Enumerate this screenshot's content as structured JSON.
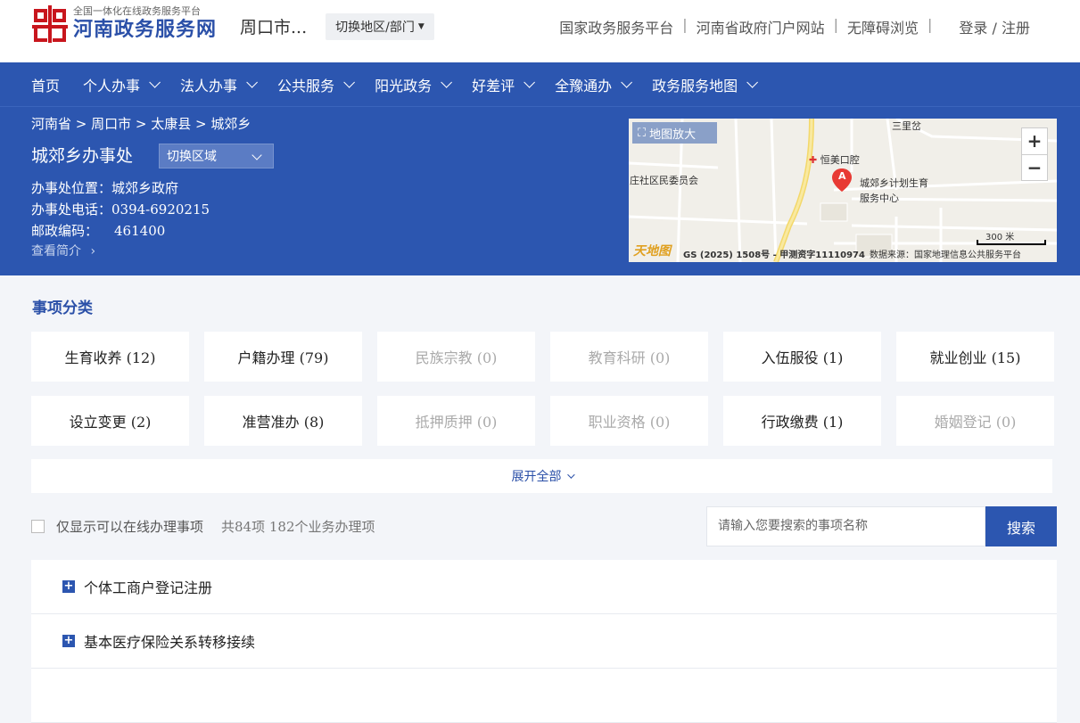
{
  "header": {
    "tagline": "全国一体化在线政务服务平台",
    "site_name": "河南政务服务网",
    "city": "周口市...",
    "switch_label": "切换地区/部门",
    "links": [
      "国家政务服务平台",
      "河南省政府门户网站",
      "无障碍浏览"
    ],
    "login": "登录 / 注册"
  },
  "nav": {
    "items": [
      {
        "label": "首页",
        "dropdown": false
      },
      {
        "label": "个人办事",
        "dropdown": true
      },
      {
        "label": "法人办事",
        "dropdown": true
      },
      {
        "label": "公共服务",
        "dropdown": true
      },
      {
        "label": "阳光政务",
        "dropdown": true
      },
      {
        "label": "好差评",
        "dropdown": true
      },
      {
        "label": "全豫通办",
        "dropdown": true
      },
      {
        "label": "政务服务地图",
        "dropdown": true
      }
    ]
  },
  "banner": {
    "breadcrumb": "河南省 > 周口市 > 太康县 > 城郊乡",
    "office_name": "城郊乡办事处",
    "area_select": "切换区域",
    "location": "办事处位置：城郊乡政府",
    "phone": "办事处电话：0394-6920215",
    "postcode_label": "邮政编码：",
    "postcode": "461400",
    "intro_link": "查看简介"
  },
  "map": {
    "enlarge_label": "地图放大",
    "zoom_in": "+",
    "zoom_out": "−",
    "labels": {
      "sanlidao": "三里岔",
      "hengmei": "恒美口腔",
      "committee": "庄社区民委员会",
      "center_line1": "城郊乡计划生育",
      "center_line2": "服务中心",
      "scale": "300 米",
      "gs": "GS (2025) 1508号 - 甲测资字11110974",
      "source": "数据来源：国家地理信息公共服务平台",
      "logo": "天地图",
      "marker": "A"
    }
  },
  "categories": {
    "title": "事项分类",
    "items": [
      {
        "label": "生育收养 (12)",
        "active": true
      },
      {
        "label": "户籍办理 (79)",
        "active": true
      },
      {
        "label": "民族宗教 (0)",
        "active": false
      },
      {
        "label": "教育科研 (0)",
        "active": false
      },
      {
        "label": "入伍服役 (1)",
        "active": true
      },
      {
        "label": "就业创业 (15)",
        "active": true
      },
      {
        "label": "设立变更 (2)",
        "active": true
      },
      {
        "label": "准营准办 (8)",
        "active": true
      },
      {
        "label": "抵押质押 (0)",
        "active": false
      },
      {
        "label": "职业资格 (0)",
        "active": false
      },
      {
        "label": "行政缴费 (1)",
        "active": true
      },
      {
        "label": "婚姻登记 (0)",
        "active": false
      }
    ],
    "expand_label": "展开全部"
  },
  "filter": {
    "online_only": "仅显示可以在线办理事项",
    "count_text": "共84项 182个业务办理项",
    "search_placeholder": "请输入您要搜索的事项名称",
    "search_button": "搜索"
  },
  "items": [
    {
      "label": "个体工商户登记注册"
    },
    {
      "label": "基本医疗保险关系转移接续"
    },
    {
      "label": ""
    }
  ],
  "colors": {
    "primary": "#2c56b0",
    "logo_red": "#c8161d",
    "page_bg": "#f3f5f9"
  }
}
